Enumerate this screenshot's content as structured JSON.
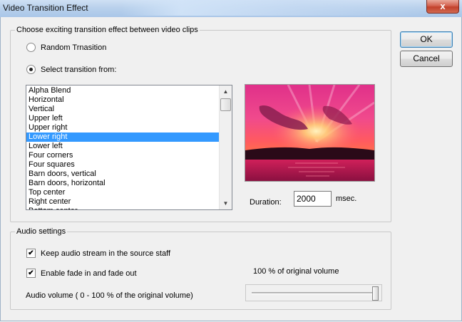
{
  "window": {
    "title": "Video Transition Effect",
    "close_glyph": "x"
  },
  "transition_group": {
    "legend": "Choose exciting transition effect between video clips",
    "random_label": "Random Trnasition",
    "random_checked": false,
    "select_label": "Select transition from:",
    "select_checked": true
  },
  "transitions": {
    "items": [
      "Alpha Blend",
      "Horizontal",
      "Vertical",
      "Upper left",
      "Upper right",
      "Lower right",
      "Lower left",
      "Four corners",
      "Four squares",
      "Barn doors, vertical",
      "Barn doors, horizontal",
      "Top center",
      "Right center",
      "Bottom center"
    ],
    "selected": "Lower right"
  },
  "duration": {
    "label": "Duration:",
    "value": "2000",
    "unit": "msec."
  },
  "buttons": {
    "ok": "OK",
    "cancel": "Cancel"
  },
  "audio_group": {
    "legend": "Audio settings",
    "keep_audio_label": "Keep audio stream in the source staff",
    "keep_audio_checked": true,
    "fade_label": "Enable fade in and fade out",
    "fade_checked": true,
    "volume_readout": "100 % of original volume",
    "volume_label": "Audio volume ( 0 - 100 % of the original volume)",
    "volume_percent": 100
  },
  "icons": {
    "checkmark": "✔",
    "scroll_up": "▲",
    "scroll_down": "▼"
  },
  "colors": {
    "selection": "#3399ff",
    "titlebar": "#b9d1ec",
    "close_button": "#c2412b"
  }
}
